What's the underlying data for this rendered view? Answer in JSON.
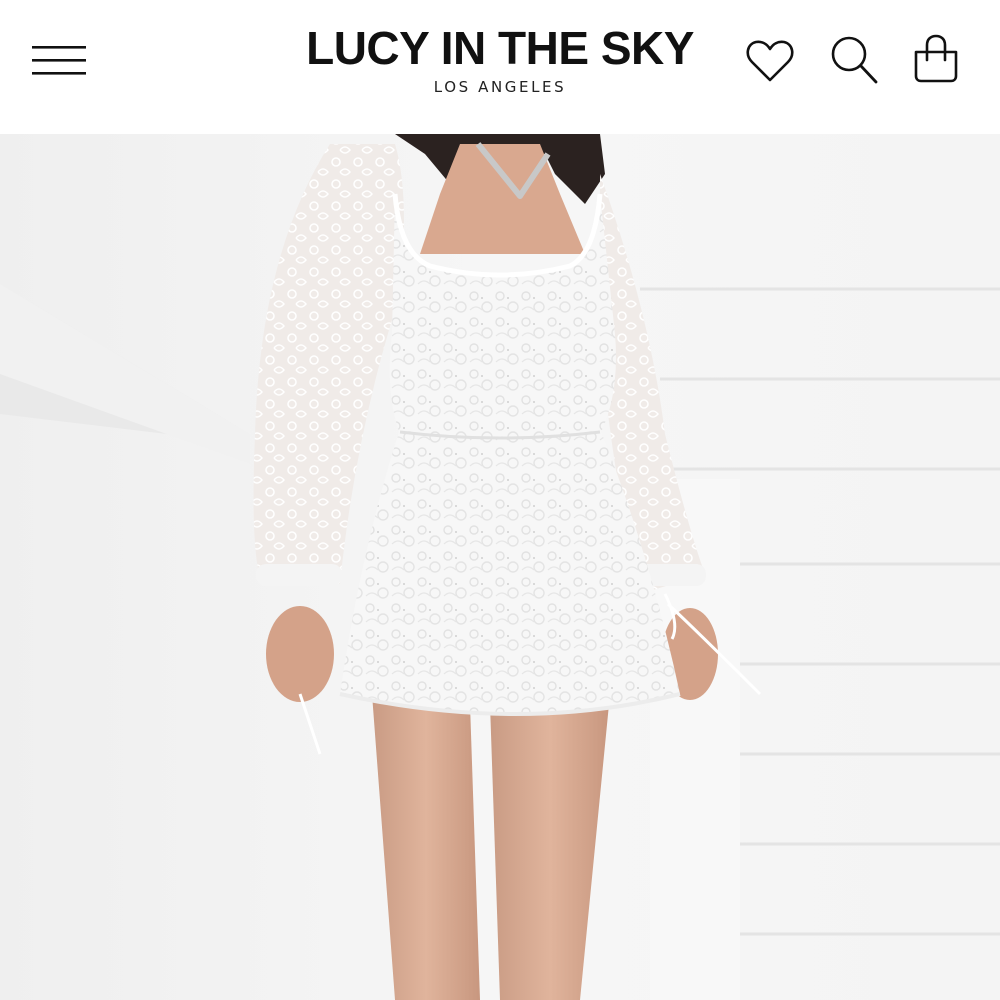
{
  "header": {
    "brand_name": "LUCY IN THE SKY",
    "brand_location": "LOS ANGELES",
    "icons": {
      "menu": "hamburger-menu-icon",
      "wishlist": "heart-icon",
      "search": "search-icon",
      "bag": "shopping-bag-icon"
    }
  },
  "hero": {
    "image": "product-photo-white-lace-mini-dress"
  },
  "colors": {
    "background": "#ffffff",
    "text": "#111111",
    "wall": "#f3f3f3",
    "stair_shadow": "#e6e6e6"
  }
}
